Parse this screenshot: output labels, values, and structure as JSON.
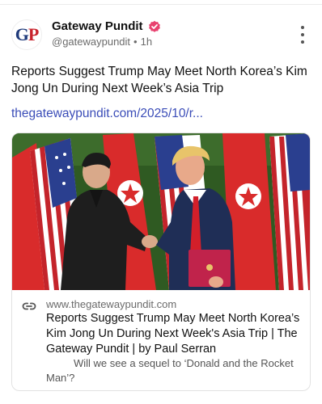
{
  "account": {
    "avatar_initials_g": "G",
    "avatar_initials_p": "P",
    "name": "Gateway Pundit",
    "handle": "@gatewaypundit",
    "separator": "•",
    "age": "1h",
    "verified_color": "#e8416f"
  },
  "post": {
    "text": "Reports Suggest Trump May Meet North Korea’s Kim Jong Un During Next Week’s Asia Trip",
    "link_text": "thegatewaypundit.com/2025/10/r..."
  },
  "link_card": {
    "domain": "www.thegatewaypundit.com",
    "title": "Reports Suggest Trump May Meet North Korea’s Kim Jong Un During Next Week's Asia Trip | The Gateway Pundit | by Paul Serran",
    "description": "Will we see a sequel to ‘Donald and the Rocket Man’?"
  },
  "icons": {
    "more": "more-vertical-icon",
    "verified": "verified-badge-icon",
    "link": "link-icon"
  },
  "colors": {
    "link": "#3b4db8",
    "brand_blue": "#1f3a7a",
    "brand_red": "#c8232c"
  }
}
